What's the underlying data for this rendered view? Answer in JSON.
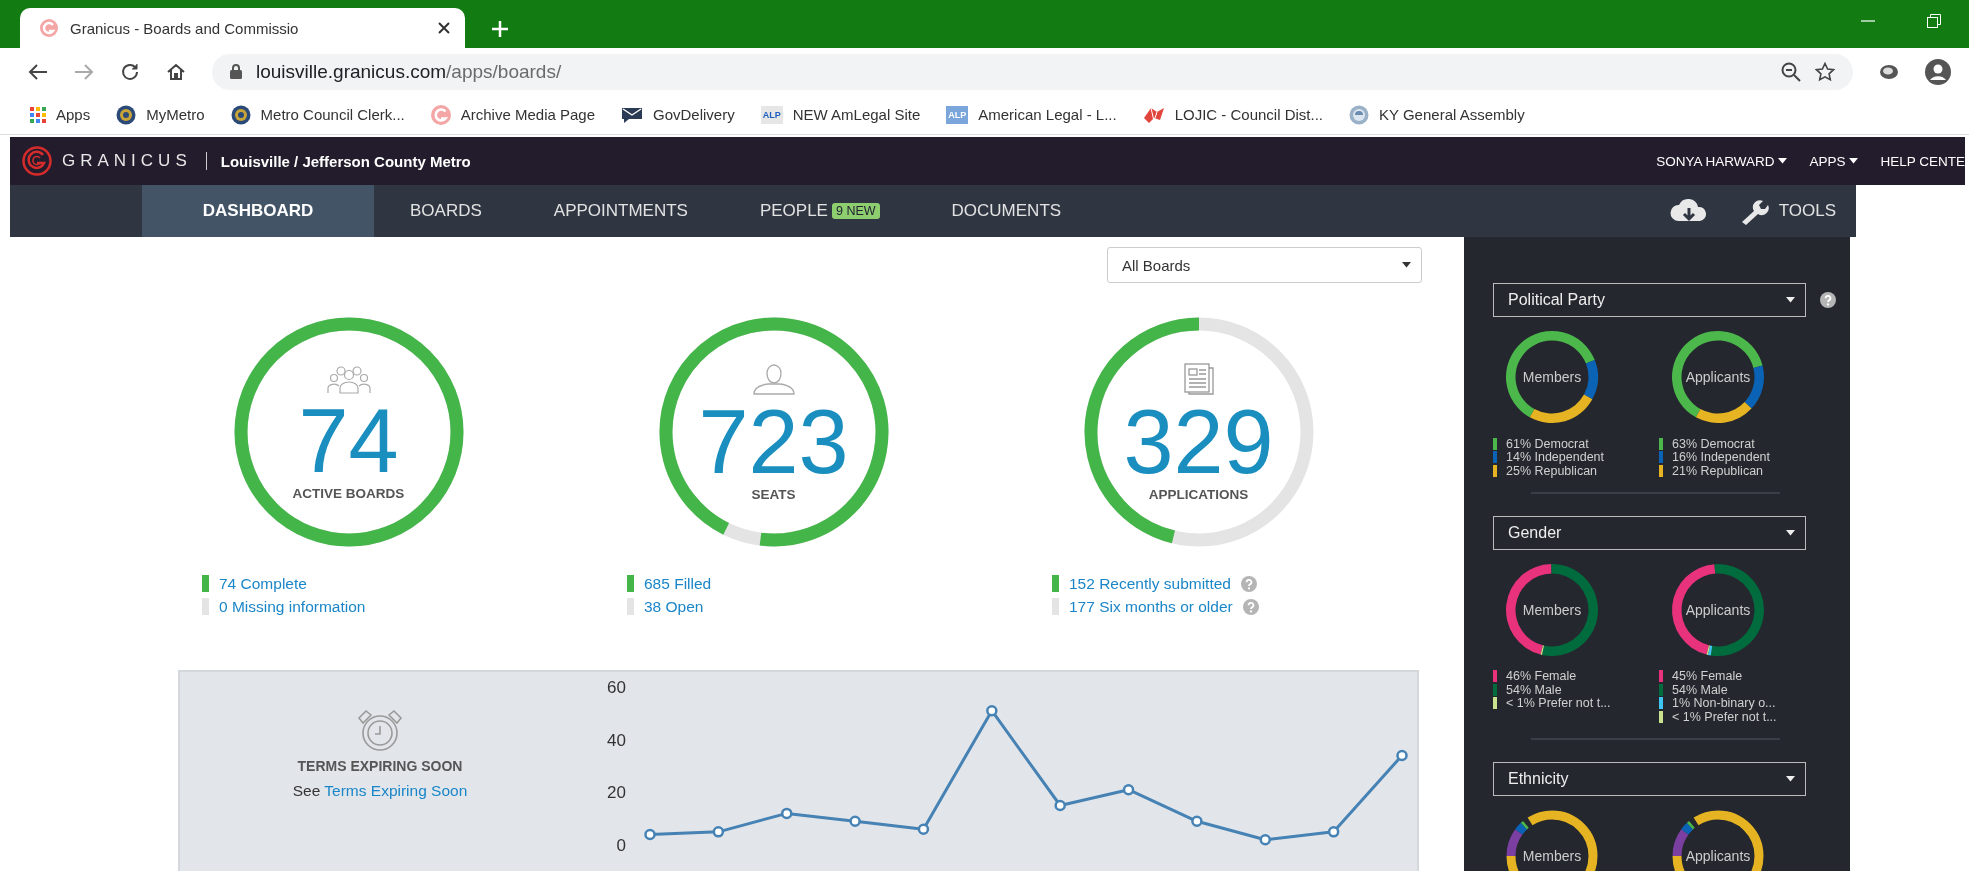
{
  "browser": {
    "tab_title": "Granicus - Boards and Commissio",
    "url_host": "louisville.granicus.com",
    "url_path": "/apps/boards/",
    "bookmarks": [
      {
        "kind": "apps",
        "label": "Apps"
      },
      {
        "kind": "seal",
        "label": "MyMetro"
      },
      {
        "kind": "seal",
        "label": "Metro Council Clerk..."
      },
      {
        "kind": "granicus",
        "label": "Archive Media Page"
      },
      {
        "kind": "mail",
        "label": "GovDelivery"
      },
      {
        "kind": "alp",
        "badge": "ALP",
        "label": "NEW AmLegal Site"
      },
      {
        "kind": "alp-blue",
        "badge": "ALP",
        "label": "American Legal - L..."
      },
      {
        "kind": "map",
        "label": "LOJIC - Council Dist..."
      },
      {
        "kind": "globe",
        "label": "KY General Assembly"
      }
    ]
  },
  "header": {
    "logo": "GRANICUS",
    "org": "Louisville / Jefferson County Metro",
    "menus": [
      {
        "label": "SONYA HARWARD",
        "has_menu": true
      },
      {
        "label": "APPS",
        "has_menu": true
      },
      {
        "label": "HELP CENTE",
        "has_menu": false
      }
    ]
  },
  "nav": {
    "tabs": [
      {
        "label": "DASHBOARD",
        "selected": true
      },
      {
        "label": "BOARDS",
        "selected": false
      },
      {
        "label": "APPOINTMENTS",
        "selected": false
      },
      {
        "label": "PEOPLE",
        "selected": false,
        "badge": "9 NEW"
      },
      {
        "label": "DOCUMENTS",
        "selected": false
      }
    ],
    "tools": "TOOLS"
  },
  "filter": {
    "value": "All Boards"
  },
  "stats": [
    {
      "kind": "group",
      "value": "74",
      "label": "ACTIVE BOARDS",
      "level": 1,
      "legend": [
        {
          "text": "74 Complete",
          "color": "#44b549",
          "help": false
        },
        {
          "text": "0 Missing information",
          "color": "#e4e4e4",
          "help": false
        }
      ]
    },
    {
      "kind": "person",
      "value": "723",
      "label": "SEATS",
      "level": 0.947,
      "legend": [
        {
          "text": "685 Filled",
          "color": "#44b549",
          "help": false
        },
        {
          "text": "38 Open",
          "color": "#e4e4e4",
          "help": false
        }
      ]
    },
    {
      "kind": "document",
      "value": "329",
      "label": "APPLICATIONS",
      "level": 0.462,
      "legend": [
        {
          "text": "152 Recently submitted",
          "color": "#44b549",
          "help": true
        },
        {
          "text": "177 Six months or older",
          "color": "#e4e4e4",
          "help": true
        }
      ]
    }
  ],
  "terms": {
    "title": "TERMS EXPIRING SOON",
    "prefix": "See",
    "link": "Terms Expiring Soon",
    "chart_data": {
      "type": "line",
      "ylim": [
        0,
        60
      ],
      "yticks": [
        0,
        20,
        40,
        60
      ],
      "categories": [
        null,
        null,
        null,
        null,
        null,
        null,
        null,
        null,
        null,
        null,
        null,
        null
      ],
      "series": [
        {
          "color": "#4682b4",
          "marker": "circle",
          "values": [
            4,
            5,
            12,
            9,
            6,
            51,
            15,
            21,
            9,
            2,
            5,
            34
          ]
        }
      ]
    }
  },
  "demographics": [
    {
      "title": "Political Party",
      "help": true,
      "charts": [
        {
          "center": "Members",
          "chart_data": {
            "type": "donut",
            "values": [
              61,
              14,
              25
            ]
          },
          "legend": [
            {
              "text": "61% Democrat",
              "color": "#4cb84c"
            },
            {
              "text": "14% Independent",
              "color": "#0b63b6"
            },
            {
              "text": "25% Republican",
              "color": "#e6b422"
            }
          ]
        },
        {
          "center": "Applicants",
          "chart_data": {
            "type": "donut",
            "values": [
              63,
              16,
              21
            ]
          },
          "legend": [
            {
              "text": "63% Democrat",
              "color": "#4cb84c"
            },
            {
              "text": "16% Independent",
              "color": "#0b63b6"
            },
            {
              "text": "21% Republican",
              "color": "#e6b422"
            }
          ]
        }
      ]
    },
    {
      "title": "Gender",
      "help": false,
      "charts": [
        {
          "center": "Members",
          "chart_data": {
            "type": "donut",
            "values": [
              46,
              54,
              0.5
            ]
          },
          "legend": [
            {
              "text": "46% Female",
              "color": "#e8327c"
            },
            {
              "text": "54% Male",
              "color": "#006b3c"
            },
            {
              "text": "< 1% Prefer not t...",
              "color": "#c9e28d"
            }
          ]
        },
        {
          "center": "Applicants",
          "chart_data": {
            "type": "donut",
            "values": [
              45,
              54,
              1,
              0.5
            ]
          },
          "legend": [
            {
              "text": "45% Female",
              "color": "#e8327c"
            },
            {
              "text": "54% Male",
              "color": "#006b3c"
            },
            {
              "text": "1% Non-binary o...",
              "color": "#3ec6f0"
            },
            {
              "text": "< 1% Prefer not t...",
              "color": "#c9e28d"
            }
          ]
        }
      ]
    },
    {
      "title": "Ethnicity",
      "help": false,
      "charts": [
        {
          "center": "Members"
        },
        {
          "center": "Applicants"
        }
      ]
    }
  ]
}
